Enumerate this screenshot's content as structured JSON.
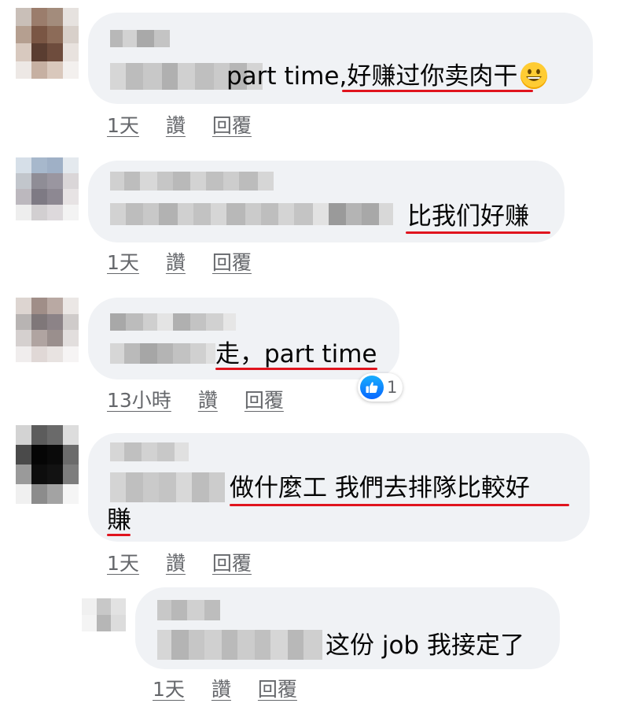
{
  "comments": [
    {
      "text": "part time,好赚过你卖肉干",
      "emoji": "grinning-face-emoji",
      "actions": {
        "time": "1天",
        "like": "讚",
        "reply": "回覆"
      }
    },
    {
      "text": "比我们好赚",
      "actions": {
        "time": "1天",
        "like": "讚",
        "reply": "回覆"
      }
    },
    {
      "text": "走，part time",
      "actions": {
        "time": "13小時",
        "like": "讚",
        "reply": "回覆"
      },
      "reaction": {
        "icon": "like-icon",
        "count": "1"
      }
    },
    {
      "text_line1": "做什麼工 我們去排隊比較好",
      "text_line2": "賺",
      "actions": {
        "time": "1天",
        "like": "讚",
        "reply": "回覆"
      }
    },
    {
      "text": "这份 job 我接定了",
      "actions": {
        "time": "1天",
        "like": "讚",
        "reply": "回覆"
      }
    }
  ],
  "colors": {
    "bubble": "#f0f2f5",
    "underline": "#e0141e",
    "meta": "#65676b",
    "like_blue": "#0866ff"
  }
}
